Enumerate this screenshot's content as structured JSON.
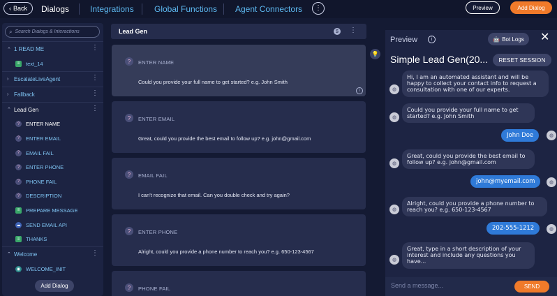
{
  "topbar": {
    "back_label": "Back",
    "nav_dialogs": "Dialogs",
    "nav_integrations": "Integrations",
    "nav_global_functions": "Global Functions",
    "nav_agent_connectors": "Agent Connectors",
    "more_label": "⋮",
    "preview_label": "Preview",
    "add_dialog_label": "Add Dialog"
  },
  "sidebar": {
    "search_placeholder": "Search Dialogs & Interactions",
    "groups": [
      {
        "label": "1 READ ME",
        "items": [
          {
            "label": "text_14"
          }
        ]
      },
      {
        "label": "EscalateLiveAgent"
      },
      {
        "label": "Fallback"
      },
      {
        "label": "Lead Gen",
        "items": [
          {
            "label": "ENTER NAME"
          },
          {
            "label": "ENTER EMAIL"
          },
          {
            "label": "EMAIL FAIL"
          },
          {
            "label": "ENTER PHONE"
          },
          {
            "label": "PHONE FAIL"
          },
          {
            "label": "DESCRIPTION"
          },
          {
            "label": "PREPARE MESSAGE"
          },
          {
            "label": "SEND EMAIL API"
          },
          {
            "label": "THANKS"
          }
        ]
      },
      {
        "label": "Welcome",
        "items": [
          {
            "label": "WELCOME_INIT"
          }
        ]
      }
    ],
    "add_dialog_label": "Add Dialog"
  },
  "main": {
    "title": "Lead Gen",
    "cards": [
      {
        "title": "ENTER NAME",
        "body": "Could you provide your full name to get started? e.g. John Smith"
      },
      {
        "title": "ENTER EMAIL",
        "body": "Great, could you provide the best email to follow up? e.g. john@gmail.com"
      },
      {
        "title": "EMAIL FAIL",
        "body": "I can't recognize that email. Can you double check and try again?"
      },
      {
        "title": "ENTER PHONE",
        "body": "Alright, could you provide a phone number to reach you? e.g. 650-123-4567"
      },
      {
        "title": "PHONE FAIL",
        "body": ""
      }
    ]
  },
  "preview": {
    "label": "Preview",
    "bot_logs_label": "Bot Logs",
    "title": "Simple Lead Gen(20...",
    "reset_label": "RESET SESSION",
    "messages": [
      {
        "from": "bot",
        "text": "Hi, I am an automated assistant and will be happy to collect your contact info to request a consultation with one of our experts."
      },
      {
        "from": "bot",
        "text": "Could you provide your full name to get started? e.g. John Smith"
      },
      {
        "from": "user",
        "text": "John Doe"
      },
      {
        "from": "bot",
        "text": "Great, could you provide the best email to follow up? e.g. john@gmail.com"
      },
      {
        "from": "user",
        "text": "john@myemail.com"
      },
      {
        "from": "bot",
        "text": "Alright, could you provide a phone number to reach you? e.g. 650-123-4567"
      },
      {
        "from": "user",
        "text": "202-555-1212"
      },
      {
        "from": "bot",
        "text": "Great, type in a short description of your interest and include any questions you have..."
      }
    ],
    "input_placeholder": "Send a message...",
    "send_label": "SEND"
  }
}
